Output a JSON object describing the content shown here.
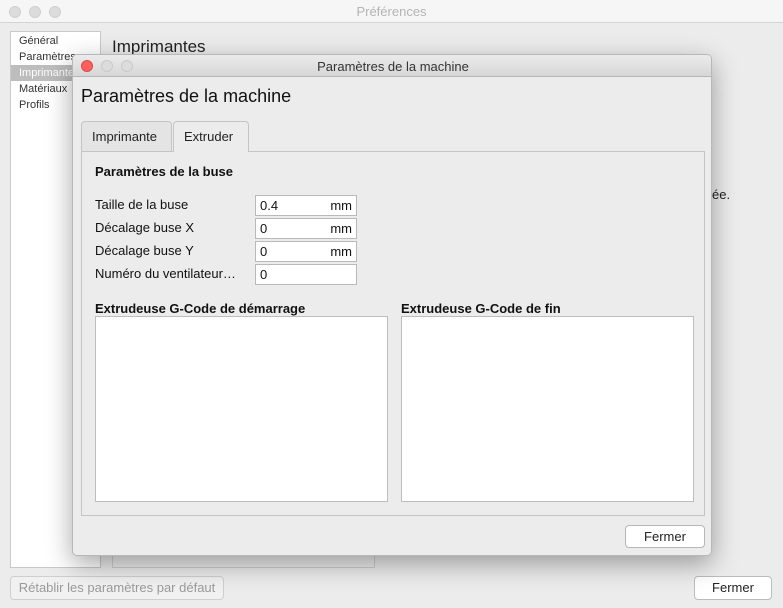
{
  "prefs_window": {
    "title": "Préférences",
    "sidebar_items": [
      "Général",
      "Paramètres",
      "Imprimantes",
      "Matériaux",
      "Profils"
    ],
    "selected_index": 2,
    "heading": "Imprimantes",
    "truncated_text": "ée.",
    "reset_button": "Rétablir les paramètres par défaut",
    "close_button": "Fermer"
  },
  "dialog": {
    "title": "Paramètres de la machine",
    "heading": "Paramètres de la machine",
    "tabs": [
      {
        "label": "Imprimante",
        "active": false
      },
      {
        "label": "Extruder",
        "active": true
      }
    ],
    "section_title": "Paramètres de la buse",
    "fields": [
      {
        "label": "Taille de la buse",
        "value": "0.4",
        "unit": "mm"
      },
      {
        "label": "Décalage buse X",
        "value": "0",
        "unit": "mm"
      },
      {
        "label": "Décalage buse Y",
        "value": "0",
        "unit": "mm"
      },
      {
        "label": "Numéro du ventilateur…",
        "value": "0",
        "unit": ""
      }
    ],
    "gcode_start_label": "Extrudeuse G-Code de démarrage",
    "gcode_end_label": "Extrudeuse G-Code de fin",
    "gcode_start_value": "",
    "gcode_end_value": "",
    "close_button": "Fermer"
  }
}
